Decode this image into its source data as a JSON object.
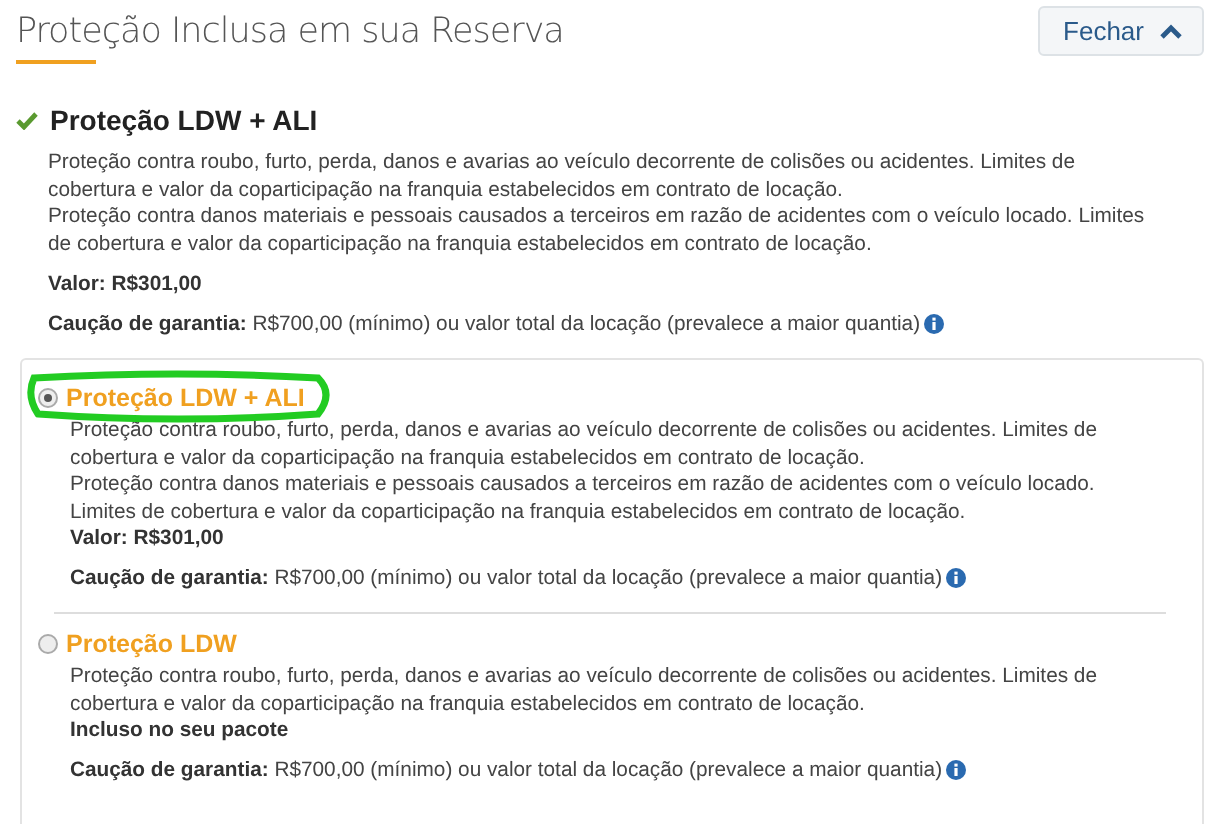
{
  "header": {
    "title": "Proteção Inclusa em sua Reserva",
    "close_button": "Fechar"
  },
  "included": {
    "title": "Proteção LDW + ALI",
    "paragraphs": [
      "Proteção contra roubo, furto, perda, danos e avarias ao veículo decorrente de colisões ou acidentes. Limites de cobertura e valor da coparticipação na franquia estabelecidos em contrato de locação.",
      "Proteção contra danos materiais e pessoais causados a terceiros em razão de acidentes com o veículo locado. Limites de cobertura e valor da coparticipação na franquia estabelecidos em contrato de locação."
    ],
    "summary": "Valor: R$301,00",
    "deposit": "**Caução de garantia:** R$700,00 (mínimo) ou valor total da locação (prevalece a maior quantia)"
  },
  "options": [
    {
      "title": "Proteção LDW + ALI",
      "selected": true,
      "highlighted": true,
      "paragraphs": [
        "Proteção contra roubo, furto, perda, danos e avarias ao veículo decorrente de colisões ou acidentes. Limites de cobertura e valor da coparticipação na franquia estabelecidos em contrato de locação.",
        "Proteção contra danos materiais e pessoais causados a terceiros em razão de acidentes com o veículo locado. Limites de cobertura e valor da coparticipação na franquia estabelecidos em contrato de locação."
      ],
      "summary": "Valor: R$301,00",
      "deposit": "**Caução de garantia:** R$700,00 (mínimo) ou valor total da locação (prevalece a maior quantia)"
    },
    {
      "title": "Proteção LDW",
      "selected": false,
      "highlighted": false,
      "paragraphs": [
        "Proteção contra roubo, furto, perda, danos e avarias ao veículo decorrente de colisões ou acidentes. Limites de cobertura e valor da coparticipação na franquia estabelecidos em contrato de locação."
      ],
      "summary": "Incluso no seu pacote",
      "deposit": "**Caução de garantia:** R$700,00 (mínimo) ou valor total da locação (prevalece a maior quantia)"
    }
  ]
}
